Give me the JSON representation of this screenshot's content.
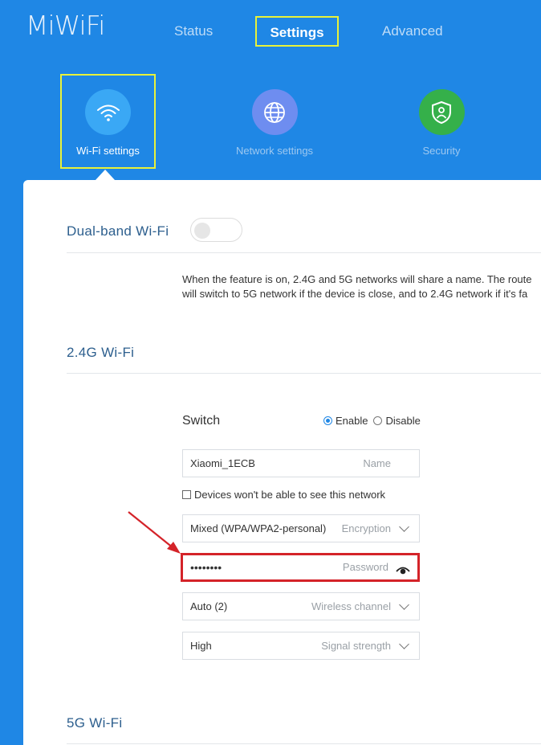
{
  "app": {
    "logo": "MiWiFi"
  },
  "topnav": {
    "tabs": [
      "Status",
      "Settings",
      "Advanced"
    ]
  },
  "subnav": {
    "items": [
      "Wi-Fi settings",
      "Network settings",
      "Security"
    ]
  },
  "dual_band": {
    "title": "Dual-band Wi-Fi",
    "enabled": false,
    "description_line1": "When the feature is on, 2.4G and 5G networks will share a name. The route",
    "description_line2": "will switch to 5G network if the device is close, and to 2.4G network if it's fa"
  },
  "wifi24": {
    "title": "2.4G Wi-Fi",
    "switch_label": "Switch",
    "enable_label": "Enable",
    "disable_label": "Disable",
    "name_value": "Xiaomi_1ECB",
    "name_hint": "Name",
    "hidden_label": "Devices won't be able to see this network",
    "encryption_value": "Mixed (WPA/WPA2-personal)",
    "encryption_hint": "Encryption",
    "password_value": "••••••••",
    "password_hint": "Password",
    "channel_value": "Auto (2)",
    "channel_hint": "Wireless channel",
    "signal_value": "High",
    "signal_hint": "Signal strength"
  },
  "wifi5": {
    "title": "5G Wi-Fi"
  },
  "colors": {
    "header_bg": "#1f87e5",
    "highlight_box": "#e8f23a",
    "annotation_red": "#d42329",
    "section_title": "#2d5f8e"
  },
  "icons": [
    "wifi-icon",
    "globe-icon",
    "shield-icon",
    "eye-icon",
    "chevron-down-icon"
  ]
}
